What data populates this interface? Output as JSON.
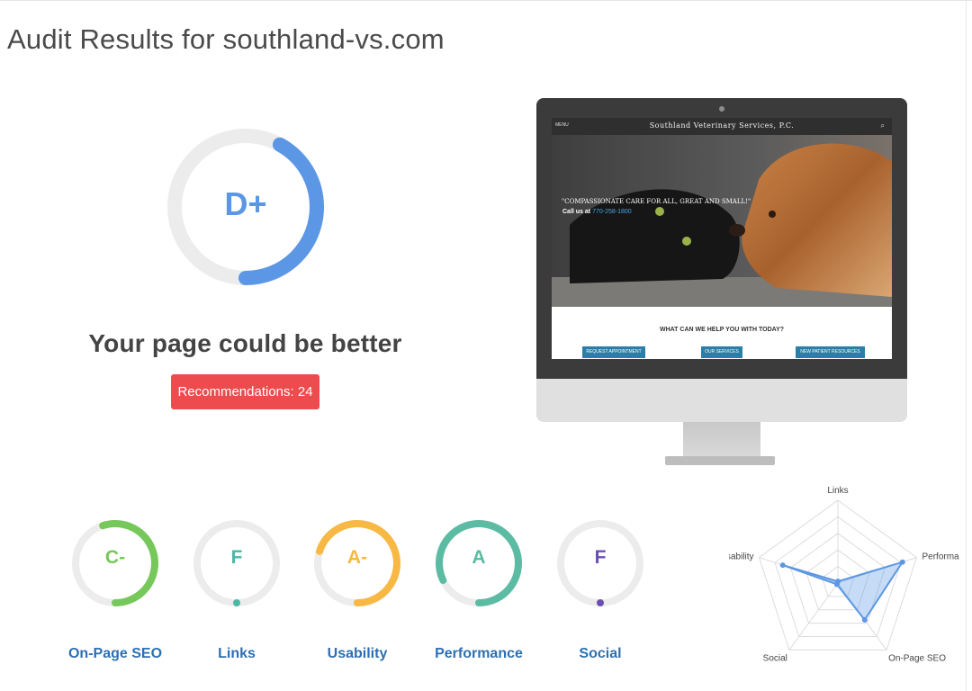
{
  "header": {
    "title": "Audit Results for southland-vs.com"
  },
  "overall": {
    "grade": "D+",
    "score_fraction": 0.42,
    "headline": "Your page could be better",
    "recommendations_label": "Recommendations: 24",
    "ring_color": "#5b97e5"
  },
  "preview": {
    "site_title": "Southland Veterinary Services, P.C.",
    "menu_label": "MENU",
    "quote": "\"COMPASSIONATE CARE FOR ALL, GREAT AND SMALL!\"",
    "call_label": "Call us at",
    "phone": "770-258-1800",
    "help_title": "WHAT CAN WE HELP YOU WITH TODAY?",
    "buttons": [
      "REQUEST APPOINTMENT",
      "OUR SERVICES",
      "NEW PATIENT RESOURCES"
    ]
  },
  "categories": [
    {
      "label": "On-Page SEO",
      "grade": "C-",
      "fraction": 0.55,
      "color": "#77c85a"
    },
    {
      "label": "Links",
      "grade": "F",
      "fraction": 0.0,
      "color": "#4ab8a4"
    },
    {
      "label": "Usability",
      "grade": "A-",
      "fraction": 0.7,
      "color": "#f7b844"
    },
    {
      "label": "Performance",
      "grade": "A",
      "fraction": 0.82,
      "color": "#5bbba3"
    },
    {
      "label": "Social",
      "grade": "F",
      "fraction": 0.0,
      "color": "#6a4fb0"
    }
  ],
  "radar": {
    "axes": [
      "Links",
      "Performance",
      "On-Page SEO",
      "Social",
      "Usability"
    ],
    "values": [
      0.0,
      0.82,
      0.55,
      0.0,
      0.7
    ],
    "color": "#5b97e5"
  }
}
